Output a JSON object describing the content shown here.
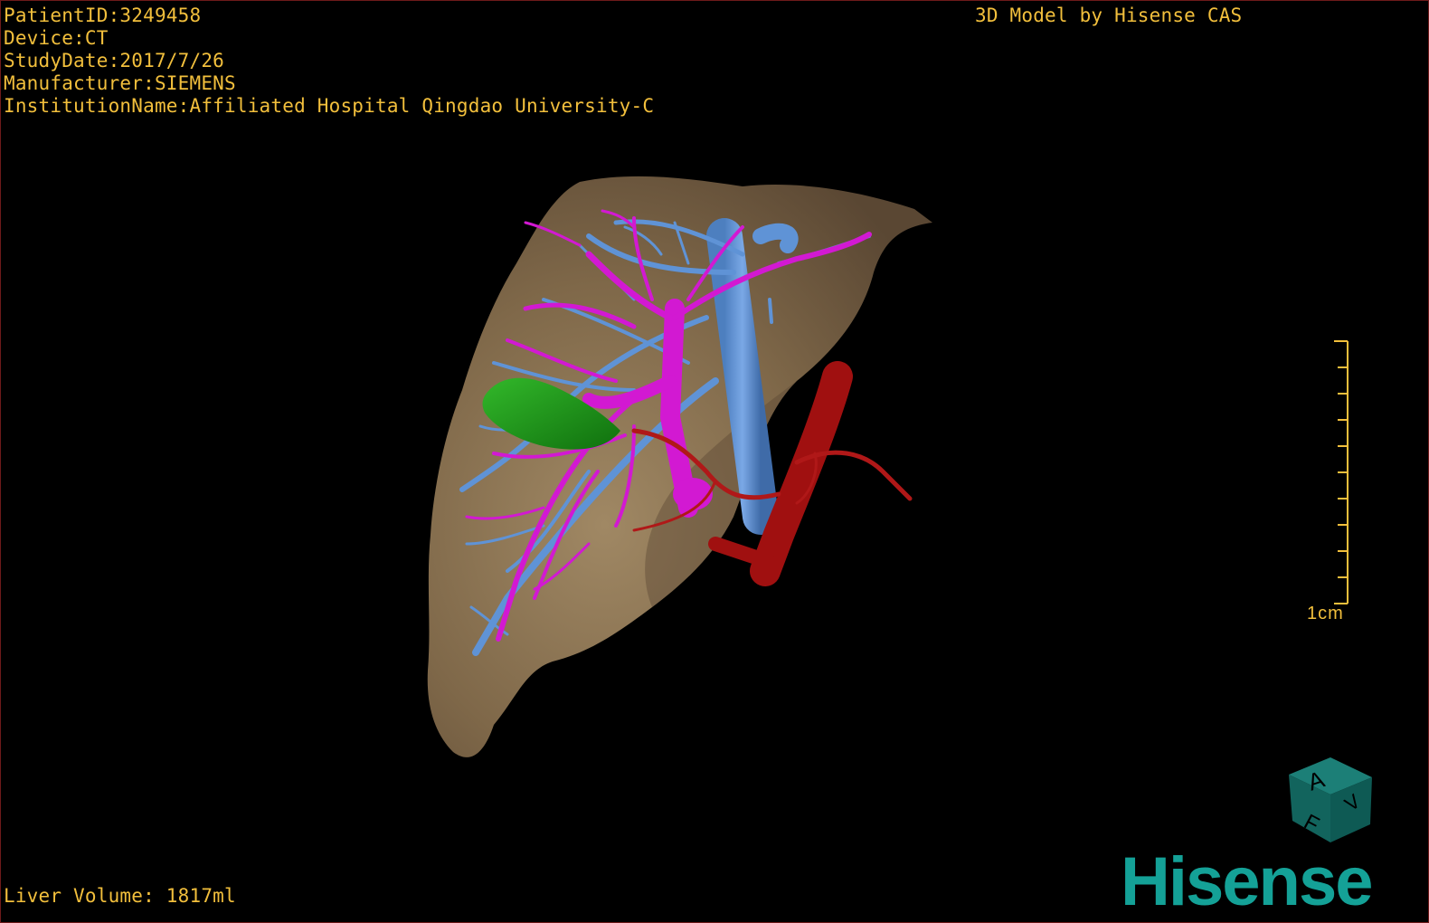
{
  "overlay": {
    "patient_id": "PatientID:3249458",
    "device": "Device:CT",
    "study_date": "StudyDate:2017/7/26",
    "manufacturer": "Manufacturer:SIEMENS",
    "institution": "InstitutionName:Affiliated Hospital Qingdao University-C",
    "credit": "3D Model by Hisense CAS",
    "liver_volume": "Liver Volume: 1817ml"
  },
  "scale": {
    "label": "1cm"
  },
  "orientation_cube": {
    "face_top": "A",
    "face_left": "F",
    "face_right": "V"
  },
  "brand": {
    "logo_text": "Hisense"
  },
  "colors": {
    "overlay_text": "#f2bf3c",
    "liver": "#7a6447",
    "portal_vein": "#d219d2",
    "hepatic_vein": "#5f93d6",
    "gallbladder": "#1e9a1a",
    "artery": "#a01010",
    "logo": "#14a197",
    "frame_border": "#6e1a1a"
  }
}
